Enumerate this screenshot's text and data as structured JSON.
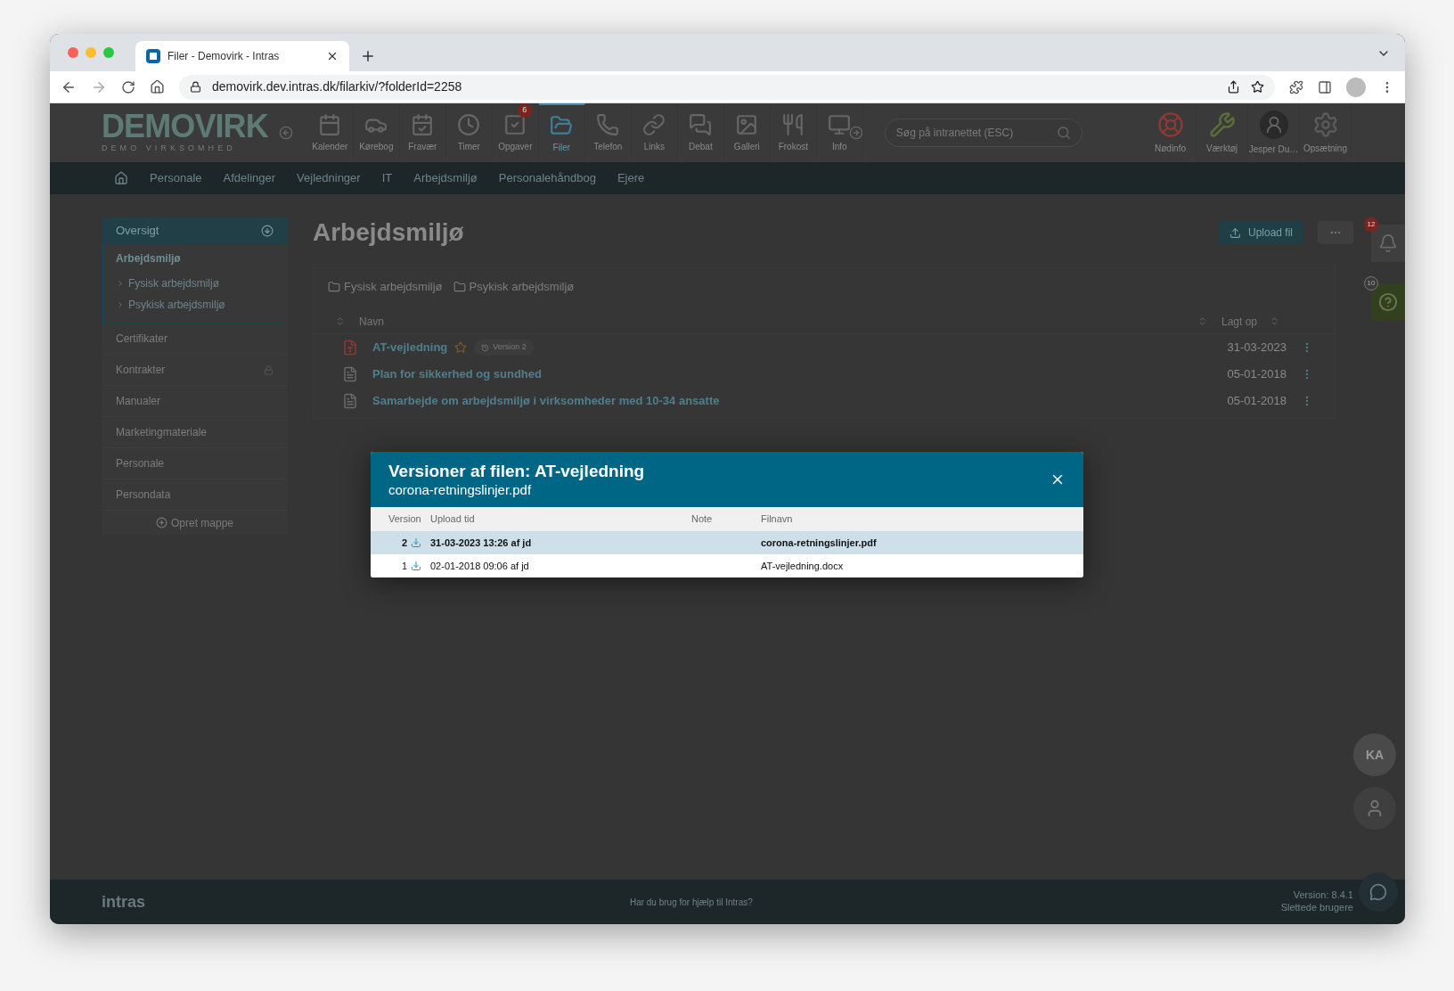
{
  "browser": {
    "tab_title": "Filer - Demovirk - Intras",
    "url": "demovirk.dev.intras.dk/filarkiv/?folderId=2258"
  },
  "header": {
    "logo": "DEMOVIRK",
    "logo_sub": "DEMO VIRKSOMHED",
    "tools": [
      {
        "label": "Kalender",
        "selected": false
      },
      {
        "label": "Kørebog",
        "selected": false
      },
      {
        "label": "Fravær",
        "selected": false
      },
      {
        "label": "Timer",
        "selected": false
      },
      {
        "label": "Opgaver",
        "selected": false,
        "badge": "6"
      },
      {
        "label": "Filer",
        "selected": true
      },
      {
        "label": "Telefon",
        "selected": false
      },
      {
        "label": "Links",
        "selected": false
      },
      {
        "label": "Debat",
        "selected": false
      },
      {
        "label": "Galleri",
        "selected": false
      },
      {
        "label": "Frokost",
        "selected": false
      },
      {
        "label": "Info",
        "selected": false
      }
    ],
    "search": {
      "placeholder": "Søg på intranettet (ESC)"
    },
    "right": [
      {
        "label": "Nødinfo"
      },
      {
        "label": "Værktøj"
      },
      {
        "label": "Jesper Du…"
      },
      {
        "label": "Opsætning"
      }
    ]
  },
  "nav": [
    "Personale",
    "Afdelinger",
    "Vejledninger",
    "IT",
    "Arbejdsmiljø",
    "Personalehåndbog",
    "Ejere"
  ],
  "sidebar": {
    "title": "Oversigt",
    "items": [
      {
        "label": "Arbejdsmiljø",
        "selected": true,
        "locked": false,
        "children": [
          {
            "label": "Fysisk arbejdsmiljø"
          },
          {
            "label": "Psykisk arbejdsmiljø"
          }
        ]
      },
      {
        "label": "Certifikater",
        "selected": false,
        "locked": false
      },
      {
        "label": "Kontrakter",
        "selected": false,
        "locked": true
      },
      {
        "label": "Manualer",
        "selected": false,
        "locked": false
      },
      {
        "label": "Marketingmateriale",
        "selected": false,
        "locked": false
      },
      {
        "label": "Personale",
        "selected": false,
        "locked": false
      },
      {
        "label": "Persondata",
        "selected": false,
        "locked": false
      }
    ],
    "create": "Opret mappe"
  },
  "main": {
    "title": "Arbejdsmiljø",
    "upload": "Upload fil",
    "folders": [
      "Fysisk arbejdsmiljø",
      "Psykisk arbejdsmiljø"
    ],
    "columns": [
      "Navn",
      "Lagt op"
    ],
    "files": [
      {
        "kind": "pdf",
        "name": "AT-vejledning",
        "favorite_icon": true,
        "version_badge": "Version 2",
        "date": "31-03-2023"
      },
      {
        "kind": "word",
        "name": "Plan for sikkerhed og sundhed",
        "favorite_icon": false,
        "date": "05-01-2018"
      },
      {
        "kind": "word",
        "name": "Samarbejde om arbejdsmiljø i virksomheder med 10-34 ansatte",
        "favorite_icon": false,
        "date": "05-01-2018"
      }
    ]
  },
  "rail": {
    "notifications": "12",
    "help": "10",
    "avatar_initials": "KA"
  },
  "footer": {
    "logo": "intras",
    "help": "Har du brug for hjælp til Intras?",
    "version": "Version: 8.4.1",
    "deleted": "Slettede brugere"
  },
  "modal": {
    "title": "Versioner af filen: AT-vejledning",
    "subtitle": "corona-retningslinjer.pdf",
    "columns": [
      "Version",
      "Upload tid",
      "Note",
      "Filnavn"
    ],
    "rows": [
      {
        "version": "2",
        "upload": "31-03-2023 13:26 af jd",
        "filename": "corona-retningslinjer.pdf",
        "selected": true
      },
      {
        "version": "1",
        "upload": "02-01-2018 09:06 af jd",
        "filename": "AT-vejledning.docx",
        "selected": false
      }
    ]
  }
}
